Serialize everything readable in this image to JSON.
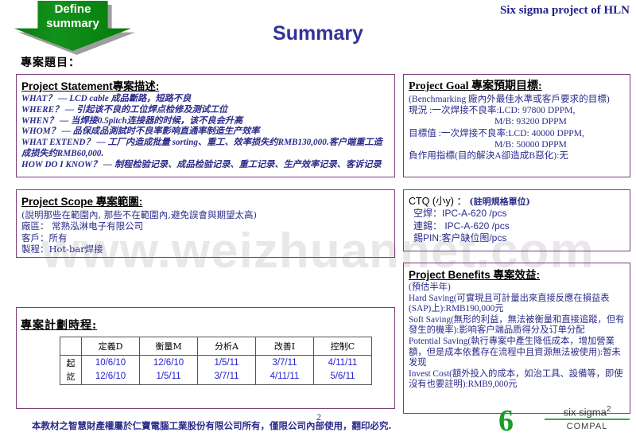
{
  "header": {
    "right_title": "Six sigma project of HLN",
    "slide_title": "Summary",
    "arrow_label_line1": "Define",
    "arrow_label_line2": "summary",
    "project_title_label": "專案題目："
  },
  "watermark": "www.weizhuannet.com",
  "statement": {
    "heading": "Project Statement專案描述:",
    "lines": [
      "WHAT？ — LCD cable 成品斷路，短路不良",
      "WHERE？ — 引起该不良的工位焊点检修及测试工位",
      "WHEN？ — 当焊接0.5pitch连接器的时候，该不良会升高",
      "WHOM？ — 品保成品測試时不良率影响直通率制造生产效率",
      "WHAT EXTEND？ — 工厂内造成批量 sorting、重工、效率损失约RMB130,000.客户端重工造成损失约RMB60,000.",
      "HOW DO I KNOW？ — 制程检验记录、成品检验记录、重工记录、生产效率记录、客诉记录"
    ]
  },
  "goal": {
    "heading": "Project Goal 專案預期目標:",
    "lines": [
      "(Benchmarking 廠內外最佳水準或客戶要求的目標)",
      "現況 :一次焊接不良率:LCD:  97800 DPPM,",
      "M/B: 93200 DPPM",
      "目標值 :一次焊接不良率:LCD:  40000 DPPM,",
      "M/B:  50000 DPPM",
      "負作用指標(目的解決A卻造成B惡化):无"
    ]
  },
  "scope": {
    "heading": "Project Scope 專案範圍:",
    "lines": [
      "(說明那些在範圍內, 那些不在範圍內,避免誤會與期望太高)",
      "廠區： 常熟泓淋电子有限公司",
      "客戶：所有",
      "製程：Hot-bar焊接"
    ]
  },
  "ctq": {
    "heading_main": "CTQ (小y) ：",
    "heading_note": "(註明規格單位)",
    "lines": [
      "空焊：IPC-A-620 /pcs",
      "連錫： IPC-A-620 /pcs",
      "錫PIN:客户缺位图/pcs"
    ]
  },
  "benefits": {
    "heading": "Project Benefits 專案效益:",
    "lines": [
      "(預估半年)",
      "Hard Saving(可實現且可計量出來直接反應在損益表(SAP)上):RMB190,000元",
      "Soft Saving(無形的利益，無法被衡量和直接追蹤，但有發生的機率):影响客户端品质得分及订单分配",
      "Potential Saving(執行專案中產生降低成本，增加營業額，但是成本依舊存在流程中且資源無法被使用):暂未发现",
      "Invest Cost(額外投入的成本，如治工具、設備等，即使沒有也要註明):RMB9,000元"
    ]
  },
  "schedule": {
    "label": "專案計劃時程:",
    "columns": [
      "",
      "定義D",
      "衡量M",
      "分析A",
      "改善I",
      "控制C"
    ],
    "row_labels": [
      "起",
      "訖"
    ],
    "start_dates": [
      "10/6/10",
      "12/6/10",
      "1/5/11",
      "3/7/11",
      "4/11/11"
    ],
    "end_dates": [
      "12/6/10",
      "1/5/11",
      "3/7/11",
      "4/11/11",
      "5/6/11"
    ]
  },
  "footer": {
    "text": "本教材之智慧財產權屬於仁寶電腦工業股份有限公司所有，僅限公司內部使用，翻印必究.",
    "page_number": "2",
    "logo_sigma": "6",
    "logo_sixsigma": "six sigma",
    "logo_sixsigma_sup": "2",
    "logo_compal": "COMPAL"
  }
}
